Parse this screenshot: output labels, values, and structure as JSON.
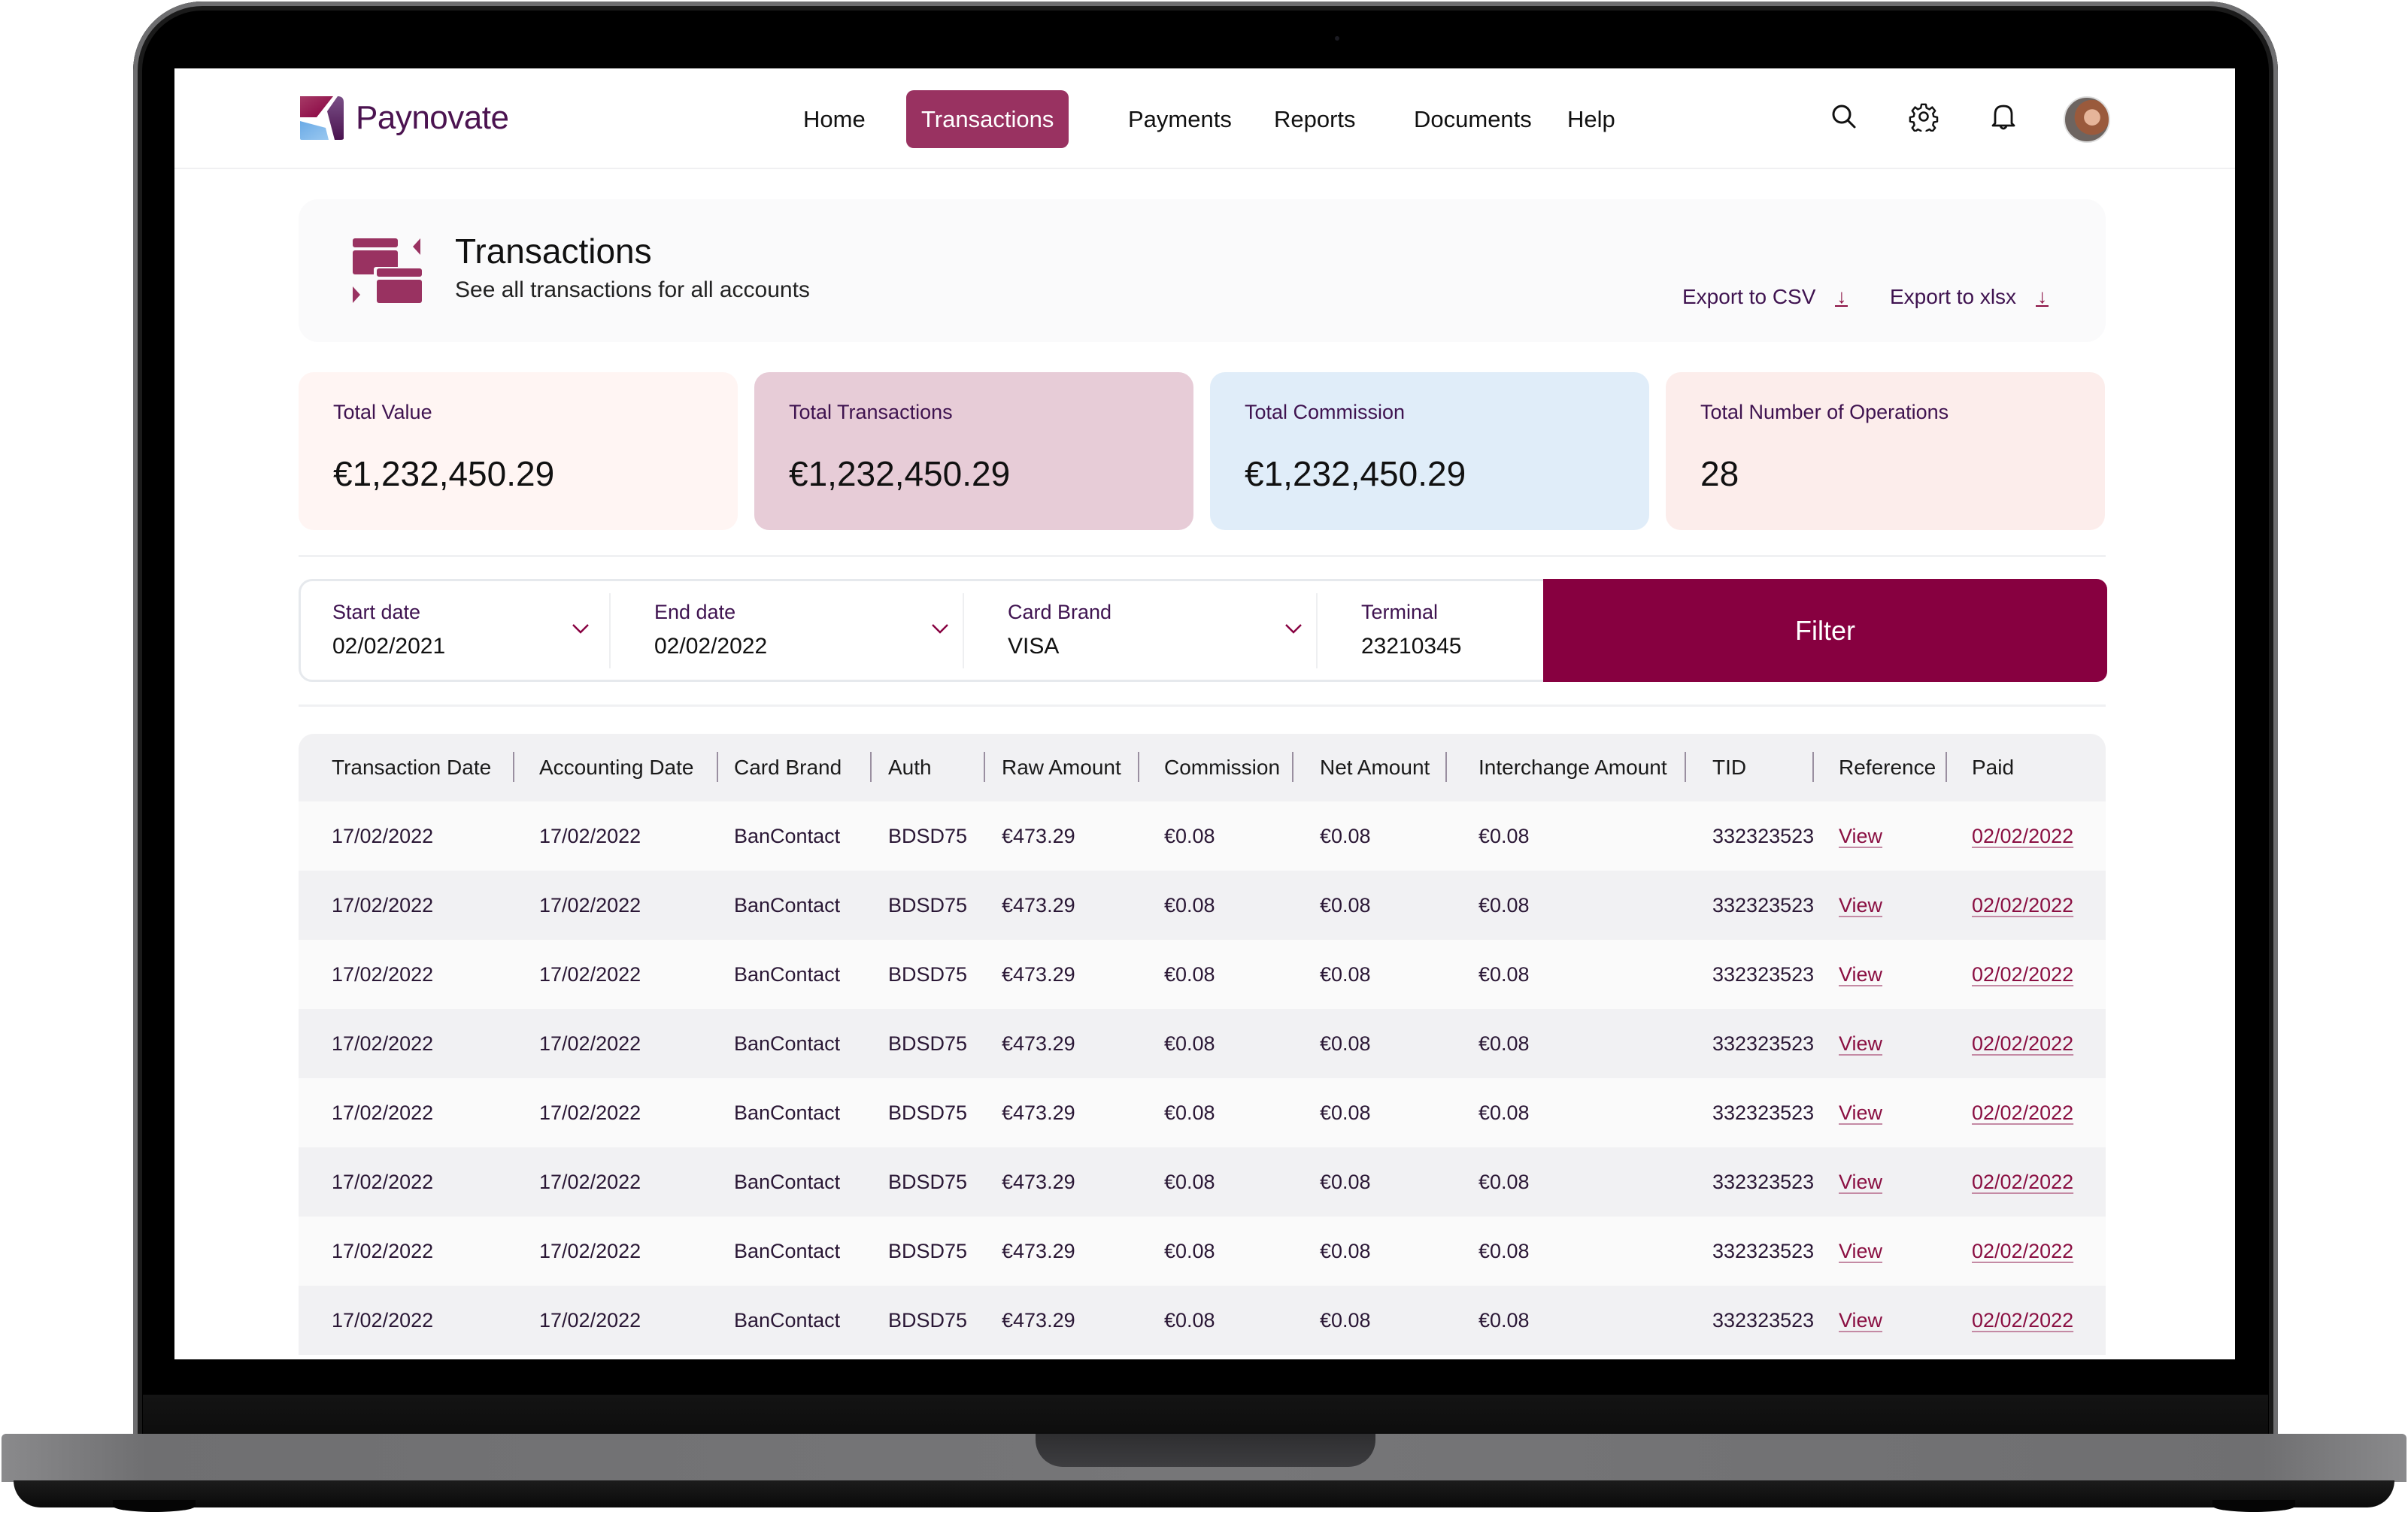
{
  "app": {
    "brand": "Paynovate"
  },
  "nav": {
    "items": [
      {
        "label": "Home",
        "active": false
      },
      {
        "label": "Transactions",
        "active": true
      },
      {
        "label": "Payments",
        "active": false
      },
      {
        "label": "Reports",
        "active": false
      },
      {
        "label": "Documents",
        "active": false
      },
      {
        "label": "Help",
        "active": false
      }
    ],
    "icons": [
      "search-icon",
      "gear-icon",
      "bell-icon",
      "avatar"
    ]
  },
  "page": {
    "title": "Transactions",
    "subtitle": "See all transactions for all accounts",
    "export_csv": "Export to CSV",
    "export_xlsx": "Export to xlsx"
  },
  "stats": [
    {
      "label": "Total Value",
      "value": "€1,232,450.29",
      "color": "#fff5f3"
    },
    {
      "label": "Total Transactions",
      "value": "€1,232,450.29",
      "color": "#e7ccd7"
    },
    {
      "label": "Total Commission",
      "value": "€1,232,450.29",
      "color": "#e0edf9"
    },
    {
      "label": "Total Number of Operations",
      "value": "28",
      "color": "#fcedeb"
    }
  ],
  "filters": {
    "fields": [
      {
        "label": "Start date",
        "value": "02/02/2021"
      },
      {
        "label": "End date",
        "value": "02/02/2022"
      },
      {
        "label": "Card Brand",
        "value": "VISA"
      },
      {
        "label": "Terminal",
        "value": "23210345"
      }
    ],
    "button": "Filter"
  },
  "table": {
    "columns": [
      "Transaction Date",
      "Accounting Date",
      "Card Brand",
      "Auth",
      "Raw Amount",
      "Commission",
      "Net Amount",
      "Interchange Amount",
      "TID",
      "Reference",
      "Paid"
    ],
    "rows": [
      [
        "17/02/2022",
        "17/02/2022",
        "BanContact",
        "BDSD75",
        "€473.29",
        "€0.08",
        "€0.08",
        "€0.08",
        "332323523",
        "View",
        "02/02/2022"
      ],
      [
        "17/02/2022",
        "17/02/2022",
        "BanContact",
        "BDSD75",
        "€473.29",
        "€0.08",
        "€0.08",
        "€0.08",
        "332323523",
        "View",
        "02/02/2022"
      ],
      [
        "17/02/2022",
        "17/02/2022",
        "BanContact",
        "BDSD75",
        "€473.29",
        "€0.08",
        "€0.08",
        "€0.08",
        "332323523",
        "View",
        "02/02/2022"
      ],
      [
        "17/02/2022",
        "17/02/2022",
        "BanContact",
        "BDSD75",
        "€473.29",
        "€0.08",
        "€0.08",
        "€0.08",
        "332323523",
        "View",
        "02/02/2022"
      ],
      [
        "17/02/2022",
        "17/02/2022",
        "BanContact",
        "BDSD75",
        "€473.29",
        "€0.08",
        "€0.08",
        "€0.08",
        "332323523",
        "View",
        "02/02/2022"
      ],
      [
        "17/02/2022",
        "17/02/2022",
        "BanContact",
        "BDSD75",
        "€473.29",
        "€0.08",
        "€0.08",
        "€0.08",
        "332323523",
        "View",
        "02/02/2022"
      ],
      [
        "17/02/2022",
        "17/02/2022",
        "BanContact",
        "BDSD75",
        "€473.29",
        "€0.08",
        "€0.08",
        "€0.08",
        "332323523",
        "View",
        "02/02/2022"
      ],
      [
        "17/02/2022",
        "17/02/2022",
        "BanContact",
        "BDSD75",
        "€473.29",
        "€0.08",
        "€0.08",
        "€0.08",
        "332323523",
        "View",
        "02/02/2022"
      ]
    ]
  },
  "colors": {
    "accent": "#870040",
    "nav_active": "#993261",
    "brand_text": "#4b1350",
    "link": "#8a0f42"
  }
}
